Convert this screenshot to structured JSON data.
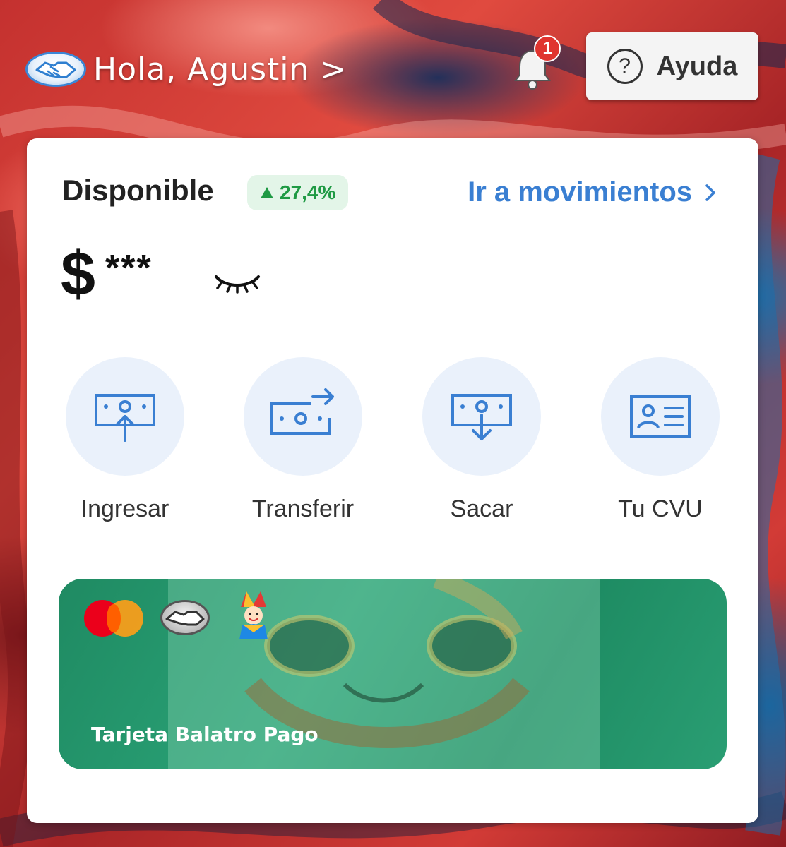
{
  "header": {
    "greeting": "Hola, Agustin >",
    "notification_count": "1",
    "help_label": "Ayuda"
  },
  "account": {
    "available_label": "Disponible",
    "change_percent": "27,4%",
    "movements_link": "Ir a movimientos",
    "currency_symbol": "$",
    "balance_masked": "***"
  },
  "actions": [
    {
      "label": "Ingresar",
      "icon": "deposit-icon"
    },
    {
      "label": "Transferir",
      "icon": "transfer-icon"
    },
    {
      "label": "Sacar",
      "icon": "withdraw-icon"
    },
    {
      "label": "Tu CVU",
      "icon": "id-card-icon"
    }
  ],
  "card": {
    "name": "Tarjeta Balatro Pago",
    "brand": "mastercard-logo"
  },
  "colors": {
    "accent_blue": "#3a7fd2",
    "positive_green": "#1f9a44",
    "card_green": "#2aa377",
    "badge_red": "#e0342f"
  }
}
